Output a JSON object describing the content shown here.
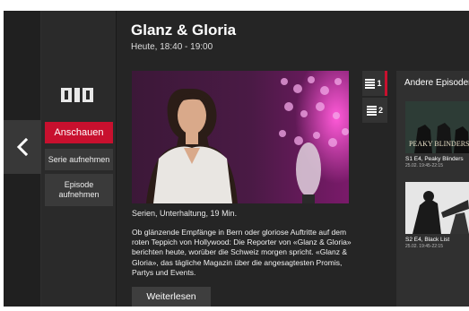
{
  "show": {
    "title": "Glanz & Gloria",
    "time": "Heute, 18:40 - 19:00",
    "meta": "Serien, Unterhaltung, 19 Min.",
    "description": "Ob glänzende Empfänge in Bern oder gloriose Auftritte auf dem roten Teppich von Hollywood: Die Reporter von «Glanz & Gloria» berichten heute, worüber die Schweiz morgen spricht. «Glanz & Gloria», das tägliche Magazin über die angesagtesten Promis, Partys und Events.",
    "read_more": "Weiterlesen"
  },
  "actions": {
    "channel_logo": "SRF 1",
    "watch": "Anschauen",
    "record_series": "Serie aufnehmen",
    "record_episode": "Episode aufnehmen"
  },
  "audio": {
    "items": [
      {
        "num": "1",
        "icon": "list-icon"
      },
      {
        "num": "2",
        "icon": "list-icon"
      }
    ]
  },
  "other": {
    "title": "Andere Episoden",
    "episodes": [
      {
        "label": "S1 E4, Peaky Blinders",
        "time": "25.02. 19:45-22:15",
        "thumb_text": "PEAKY BLINDERS"
      },
      {
        "label": "S2 E4, Black List",
        "time": "25.02. 19:45-22:15"
      }
    ]
  },
  "colors": {
    "accent": "#c8102e",
    "background": "#252525"
  }
}
